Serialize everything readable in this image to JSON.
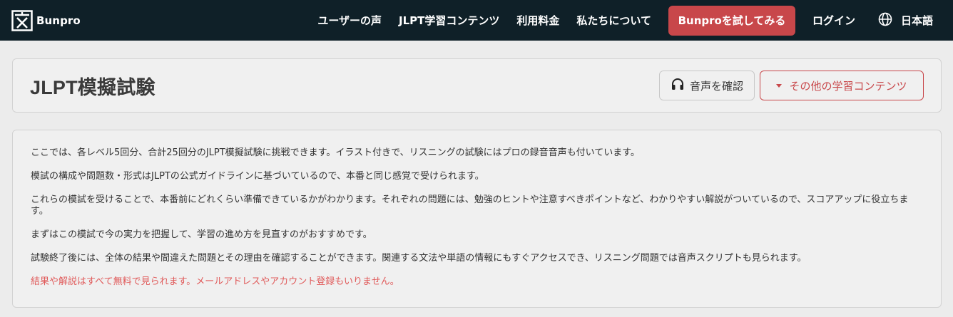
{
  "nav": {
    "brand_name": "Bunpro",
    "logo_icon": "bunpro-logo-icon",
    "links": [
      "ユーザーの声",
      "JLPT学習コンテンツ",
      "利用料金",
      "私たちについて"
    ],
    "try_button": "Bunproを試してみる",
    "login": "ログイン",
    "language": "日本語",
    "language_icon": "globe-icon",
    "colors": {
      "background": "#0f2028",
      "accent": "#c8474a"
    }
  },
  "header": {
    "title": "JLPT模擬試験",
    "audio_button": "音声を確認",
    "audio_icon": "headphones-icon",
    "other_button": "その他の学習コンテンツ",
    "other_icon": "caret-down-icon"
  },
  "content": {
    "paragraphs": [
      "ここでは、各レベル5回分、合計25回分のJLPT模擬試験に挑戦できます。イラスト付きで、リスニングの試験にはプロの録音音声も付いています。",
      "模試の構成や問題数・形式はJLPTの公式ガイドラインに基づいているので、本番と同じ感覚で受けられます。",
      "これらの模試を受けることで、本番前にどれくらい準備できているかがわかります。それぞれの問題には、勉強のヒントや注意すべきポイントなど、わかりやすい解説がついているので、スコアアップに役立ちます。",
      "まずはこの模試で今の実力を把握して、学習の進め方を見直すのがおすすめです。",
      "試験終了後には、全体の結果や間違えた問題とその理由を確認することができます。関連する文法や単語の情報にもすぐアクセスでき、リスニング問題では音声スクリプトも見られます。"
    ],
    "notice": "結果や解説はすべて無料で見られます。メールアドレスやアカウント登録もいりません。",
    "notice_color": "#e05b5b"
  }
}
